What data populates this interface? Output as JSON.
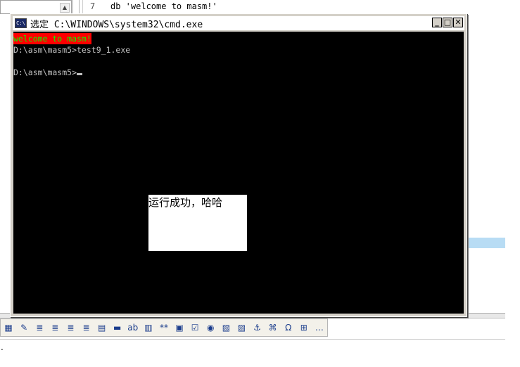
{
  "background_editor": {
    "line_number": "7",
    "code_line": "db 'welcome to masm!'",
    "scroll_arrow": "▲"
  },
  "cmd": {
    "title": "选定 C:\\WINDOWS\\system32\\cmd.exe",
    "icon_label": "C:\\",
    "controls": {
      "minimize": "_",
      "maximize": "□",
      "close": "✕"
    },
    "console_lines": [
      "welcome to masm!",
      "D:\\asm\\masm5>test9_1.exe",
      "D:\\asm\\masm5>"
    ]
  },
  "message": {
    "text": "运行成功，哈哈"
  },
  "toolbar": {
    "buttons": [
      {
        "icon": "table-icon",
        "glyph": "▦"
      },
      {
        "icon": "edit-icon",
        "glyph": "✎"
      },
      {
        "icon": "align-left-icon",
        "glyph": "≣"
      },
      {
        "icon": "align-center-icon",
        "glyph": "≣"
      },
      {
        "icon": "align-right-icon",
        "glyph": "≣"
      },
      {
        "icon": "justify-icon",
        "glyph": "≣"
      },
      {
        "icon": "form-icon",
        "glyph": "▤"
      },
      {
        "icon": "hr-icon",
        "glyph": "▬"
      },
      {
        "icon": "textfield-icon",
        "glyph": "ab"
      },
      {
        "icon": "textarea-icon",
        "glyph": "▥"
      },
      {
        "icon": "password-icon",
        "glyph": "**"
      },
      {
        "icon": "hidden-field-icon",
        "glyph": "▣"
      },
      {
        "icon": "checkbox-icon",
        "glyph": "☑"
      },
      {
        "icon": "radio-icon",
        "glyph": "◉"
      },
      {
        "icon": "image-button-icon",
        "glyph": "▧"
      },
      {
        "icon": "image-icon",
        "glyph": "▨"
      },
      {
        "icon": "anchor-icon",
        "glyph": "⚓"
      },
      {
        "icon": "script-icon",
        "glyph": "⌘"
      },
      {
        "icon": "special-char-icon",
        "glyph": "Ω"
      },
      {
        "icon": "plugin-icon",
        "glyph": "⊞"
      },
      {
        "icon": "more-icon",
        "glyph": "…"
      }
    ]
  },
  "bottom": {
    "marker": "."
  }
}
